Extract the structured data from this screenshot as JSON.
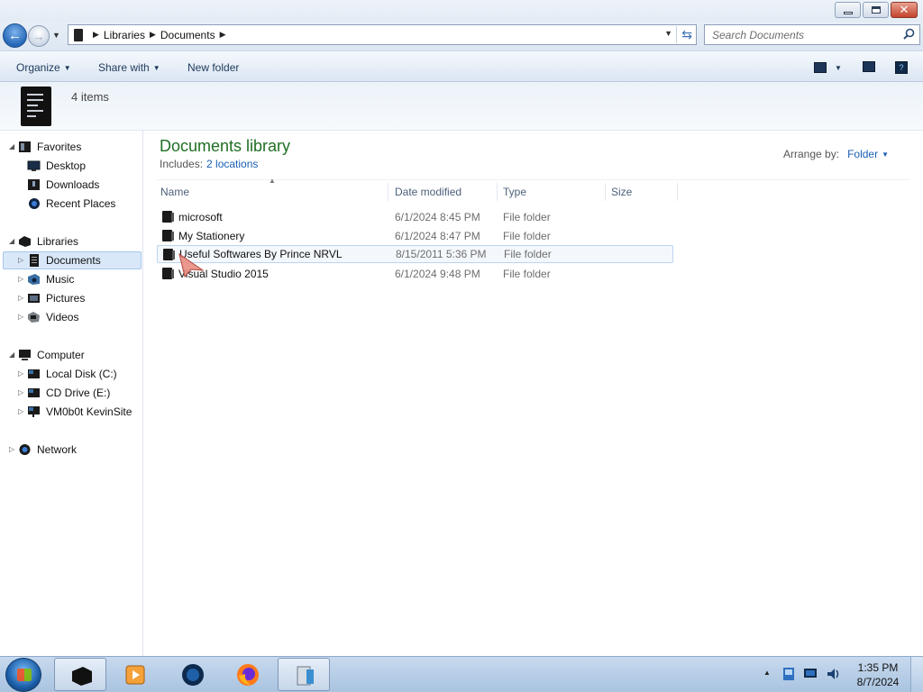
{
  "window": {
    "min_glyph": "",
    "max_glyph": "",
    "close_glyph": "✕"
  },
  "nav": {
    "back_glyph": "←",
    "forward_glyph": "→",
    "breadcrumbs": [
      "Libraries",
      "Documents"
    ],
    "search_placeholder": "Search Documents"
  },
  "toolbar": {
    "organize": "Organize",
    "share_with": "Share with",
    "new_folder": "New folder",
    "help_glyph": "?"
  },
  "details": {
    "item_count": "4 items"
  },
  "sidebar": {
    "favorites": {
      "label": "Favorites",
      "items": [
        "Desktop",
        "Downloads",
        "Recent Places"
      ]
    },
    "libraries": {
      "label": "Libraries",
      "items": [
        "Documents",
        "Music",
        "Pictures",
        "Videos"
      ],
      "selected": "Documents"
    },
    "computer": {
      "label": "Computer",
      "items": [
        "Local Disk (C:)",
        "CD Drive (E:)",
        "VM0b0t KevinSite"
      ]
    },
    "network": {
      "label": "Network"
    }
  },
  "library": {
    "title": "Documents library",
    "includes_label": "Includes:",
    "includes_link": "2 locations",
    "arrange_label": "Arrange by:",
    "arrange_value": "Folder"
  },
  "columns": [
    "Name",
    "Date modified",
    "Type",
    "Size"
  ],
  "files": [
    {
      "name": "microsoft",
      "date": "6/1/2024 8:45 PM",
      "type": "File folder"
    },
    {
      "name": "My Stationery",
      "date": "6/1/2024 8:47 PM",
      "type": "File folder"
    },
    {
      "name": "Useful Softwares By Prince NRVL",
      "date": "8/15/2011 5:36 PM",
      "type": "File folder"
    },
    {
      "name": "Visual Studio 2015",
      "date": "6/1/2024 9:48 PM",
      "type": "File folder"
    }
  ],
  "taskbar": {
    "time": "1:35 PM",
    "date": "8/7/2024",
    "tray_arrow": "▲"
  },
  "colors": {
    "title_green": "#1f6f23",
    "link_blue": "#1a5fb4",
    "selection": "#d9e8f9"
  }
}
